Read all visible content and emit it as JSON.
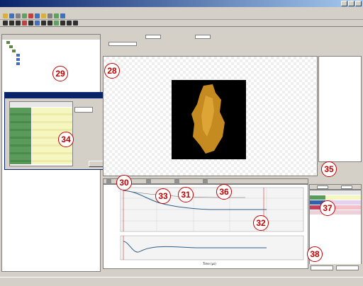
{
  "callouts": {
    "c28": "28",
    "c29": "29",
    "c30": "30",
    "c31": "31",
    "c32": "32",
    "c33": "33",
    "c34": "34",
    "c35": "35",
    "c36": "36",
    "c37": "37",
    "c38": "38"
  },
  "chart": {
    "xlabel": "Time (µs)"
  },
  "colors": {
    "titlebar": "#0a246a",
    "callout": "#c00000",
    "curve": "#2b5f8a"
  }
}
